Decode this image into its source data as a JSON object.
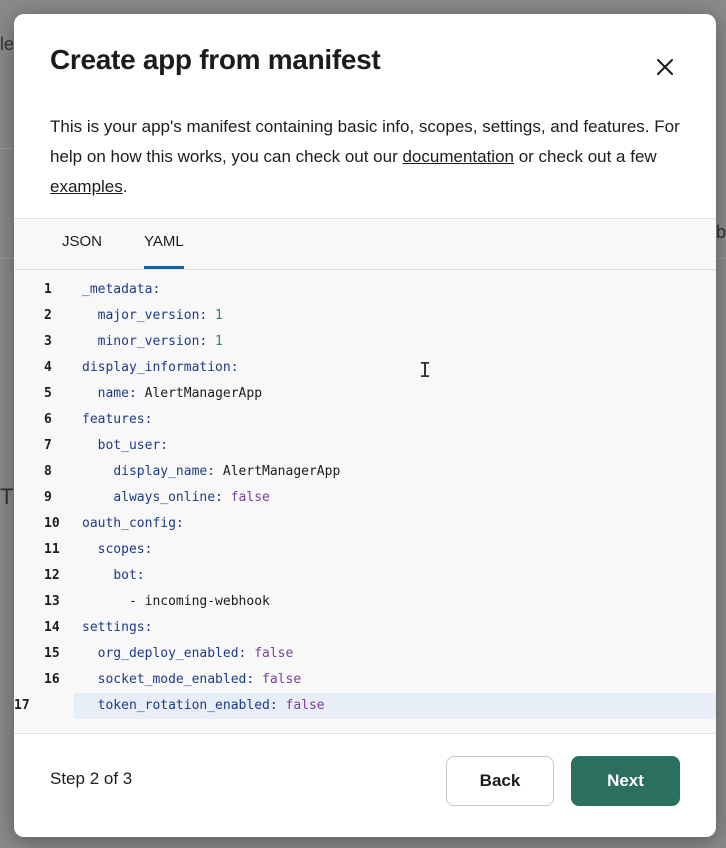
{
  "background": {
    "fragments": [
      "le",
      "T",
      "b"
    ]
  },
  "modal": {
    "title": "Create app from manifest",
    "description": {
      "text1": "This is your app's manifest containing basic info, scopes, settings, and features. For help on how this works, you can check out our ",
      "link1": "documentation",
      "text2": " or check out a few ",
      "link2": "examples",
      "text3": "."
    },
    "tabs": [
      {
        "label": "JSON",
        "active": false
      },
      {
        "label": "YAML",
        "active": true
      }
    ],
    "code_lines": [
      {
        "num": "1",
        "indent": "",
        "key": "_metadata:",
        "value": "",
        "vtype": ""
      },
      {
        "num": "2",
        "indent": "  ",
        "key": "major_version:",
        "value": " 1",
        "vtype": "n"
      },
      {
        "num": "3",
        "indent": "  ",
        "key": "minor_version:",
        "value": " 1",
        "vtype": "n"
      },
      {
        "num": "4",
        "indent": "",
        "key": "display_information:",
        "value": "",
        "vtype": ""
      },
      {
        "num": "5",
        "indent": "  ",
        "key": "name:",
        "value": " AlertManagerApp",
        "vtype": "v"
      },
      {
        "num": "6",
        "indent": "",
        "key": "features:",
        "value": "",
        "vtype": ""
      },
      {
        "num": "7",
        "indent": "  ",
        "key": "bot_user:",
        "value": "",
        "vtype": ""
      },
      {
        "num": "8",
        "indent": "    ",
        "key": "display_name:",
        "value": " AlertManagerApp",
        "vtype": "v"
      },
      {
        "num": "9",
        "indent": "    ",
        "key": "always_online:",
        "value": " false",
        "vtype": "b"
      },
      {
        "num": "10",
        "indent": "",
        "key": "oauth_config:",
        "value": "",
        "vtype": ""
      },
      {
        "num": "11",
        "indent": "  ",
        "key": "scopes:",
        "value": "",
        "vtype": ""
      },
      {
        "num": "12",
        "indent": "    ",
        "key": "bot:",
        "value": "",
        "vtype": ""
      },
      {
        "num": "13",
        "indent": "      ",
        "key": "",
        "value": "- incoming-webhook",
        "vtype": "v"
      },
      {
        "num": "14",
        "indent": "",
        "key": "settings:",
        "value": "",
        "vtype": ""
      },
      {
        "num": "15",
        "indent": "  ",
        "key": "org_deploy_enabled:",
        "value": " false",
        "vtype": "b"
      },
      {
        "num": "16",
        "indent": "  ",
        "key": "socket_mode_enabled:",
        "value": " false",
        "vtype": "b"
      },
      {
        "num": "17",
        "indent": "  ",
        "key": "token_rotation_enabled:",
        "value": " false",
        "vtype": "b"
      }
    ],
    "active_line": "17",
    "step_label": "Step 2 of 3",
    "back_label": "Back",
    "next_label": "Next"
  },
  "colors": {
    "primary_button": "#2b6f5f",
    "tab_underline": "#1264a3"
  }
}
